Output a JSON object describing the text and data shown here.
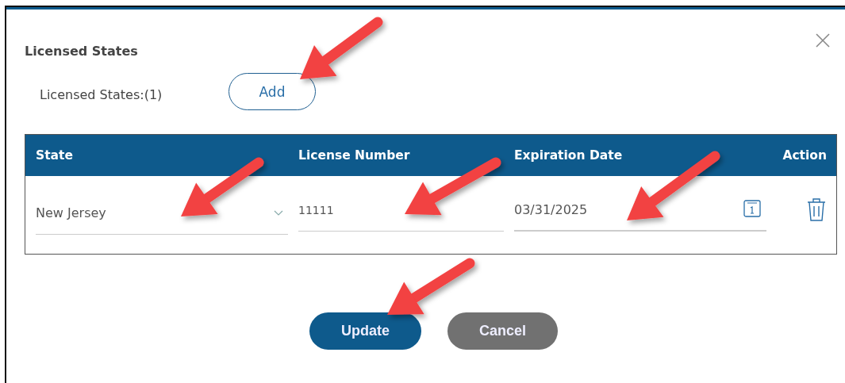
{
  "dialog": {
    "title": "Licensed States"
  },
  "count_label": "Licensed States:(1)",
  "add_button": "Add",
  "table": {
    "columns": [
      "State",
      "License Number",
      "Expiration Date",
      "Action"
    ],
    "rows": [
      {
        "state": "New Jersey",
        "license_number": "11111",
        "expiration_date": "03/31/2025"
      }
    ]
  },
  "buttons": [
    {
      "label": "Update",
      "kind": "primary"
    },
    {
      "label": "Cancel",
      "kind": "secondary"
    }
  ]
}
